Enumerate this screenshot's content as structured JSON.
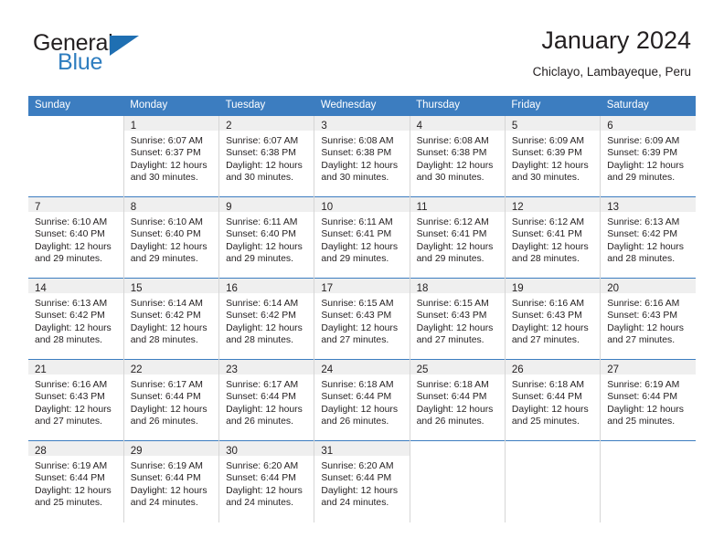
{
  "brand": {
    "word1": "General",
    "word2": "Blue",
    "accent_color": "#2E7DBF",
    "triangle_color": "#1F6FB2",
    "icon": "brand-triangle-icon"
  },
  "header": {
    "title": "January 2024",
    "location": "Chiclayo, Lambayeque, Peru"
  },
  "theme": {
    "header_blue": "#3C7DC0",
    "daynum_band": "#EFEFEF",
    "grid_line": "#D6D6D6",
    "text": "#231F20"
  },
  "calendar": {
    "weekday_headers": [
      "Sunday",
      "Monday",
      "Tuesday",
      "Wednesday",
      "Thursday",
      "Friday",
      "Saturday"
    ],
    "weeks": [
      [
        {
          "empty": true
        },
        {
          "day": "1",
          "sunrise": "Sunrise: 6:07 AM",
          "sunset": "Sunset: 6:37 PM",
          "daylight1": "Daylight: 12 hours",
          "daylight2": "and 30 minutes."
        },
        {
          "day": "2",
          "sunrise": "Sunrise: 6:07 AM",
          "sunset": "Sunset: 6:38 PM",
          "daylight1": "Daylight: 12 hours",
          "daylight2": "and 30 minutes."
        },
        {
          "day": "3",
          "sunrise": "Sunrise: 6:08 AM",
          "sunset": "Sunset: 6:38 PM",
          "daylight1": "Daylight: 12 hours",
          "daylight2": "and 30 minutes."
        },
        {
          "day": "4",
          "sunrise": "Sunrise: 6:08 AM",
          "sunset": "Sunset: 6:38 PM",
          "daylight1": "Daylight: 12 hours",
          "daylight2": "and 30 minutes."
        },
        {
          "day": "5",
          "sunrise": "Sunrise: 6:09 AM",
          "sunset": "Sunset: 6:39 PM",
          "daylight1": "Daylight: 12 hours",
          "daylight2": "and 30 minutes."
        },
        {
          "day": "6",
          "sunrise": "Sunrise: 6:09 AM",
          "sunset": "Sunset: 6:39 PM",
          "daylight1": "Daylight: 12 hours",
          "daylight2": "and 29 minutes."
        }
      ],
      [
        {
          "day": "7",
          "sunrise": "Sunrise: 6:10 AM",
          "sunset": "Sunset: 6:40 PM",
          "daylight1": "Daylight: 12 hours",
          "daylight2": "and 29 minutes."
        },
        {
          "day": "8",
          "sunrise": "Sunrise: 6:10 AM",
          "sunset": "Sunset: 6:40 PM",
          "daylight1": "Daylight: 12 hours",
          "daylight2": "and 29 minutes."
        },
        {
          "day": "9",
          "sunrise": "Sunrise: 6:11 AM",
          "sunset": "Sunset: 6:40 PM",
          "daylight1": "Daylight: 12 hours",
          "daylight2": "and 29 minutes."
        },
        {
          "day": "10",
          "sunrise": "Sunrise: 6:11 AM",
          "sunset": "Sunset: 6:41 PM",
          "daylight1": "Daylight: 12 hours",
          "daylight2": "and 29 minutes."
        },
        {
          "day": "11",
          "sunrise": "Sunrise: 6:12 AM",
          "sunset": "Sunset: 6:41 PM",
          "daylight1": "Daylight: 12 hours",
          "daylight2": "and 29 minutes."
        },
        {
          "day": "12",
          "sunrise": "Sunrise: 6:12 AM",
          "sunset": "Sunset: 6:41 PM",
          "daylight1": "Daylight: 12 hours",
          "daylight2": "and 28 minutes."
        },
        {
          "day": "13",
          "sunrise": "Sunrise: 6:13 AM",
          "sunset": "Sunset: 6:42 PM",
          "daylight1": "Daylight: 12 hours",
          "daylight2": "and 28 minutes."
        }
      ],
      [
        {
          "day": "14",
          "sunrise": "Sunrise: 6:13 AM",
          "sunset": "Sunset: 6:42 PM",
          "daylight1": "Daylight: 12 hours",
          "daylight2": "and 28 minutes."
        },
        {
          "day": "15",
          "sunrise": "Sunrise: 6:14 AM",
          "sunset": "Sunset: 6:42 PM",
          "daylight1": "Daylight: 12 hours",
          "daylight2": "and 28 minutes."
        },
        {
          "day": "16",
          "sunrise": "Sunrise: 6:14 AM",
          "sunset": "Sunset: 6:42 PM",
          "daylight1": "Daylight: 12 hours",
          "daylight2": "and 28 minutes."
        },
        {
          "day": "17",
          "sunrise": "Sunrise: 6:15 AM",
          "sunset": "Sunset: 6:43 PM",
          "daylight1": "Daylight: 12 hours",
          "daylight2": "and 27 minutes."
        },
        {
          "day": "18",
          "sunrise": "Sunrise: 6:15 AM",
          "sunset": "Sunset: 6:43 PM",
          "daylight1": "Daylight: 12 hours",
          "daylight2": "and 27 minutes."
        },
        {
          "day": "19",
          "sunrise": "Sunrise: 6:16 AM",
          "sunset": "Sunset: 6:43 PM",
          "daylight1": "Daylight: 12 hours",
          "daylight2": "and 27 minutes."
        },
        {
          "day": "20",
          "sunrise": "Sunrise: 6:16 AM",
          "sunset": "Sunset: 6:43 PM",
          "daylight1": "Daylight: 12 hours",
          "daylight2": "and 27 minutes."
        }
      ],
      [
        {
          "day": "21",
          "sunrise": "Sunrise: 6:16 AM",
          "sunset": "Sunset: 6:43 PM",
          "daylight1": "Daylight: 12 hours",
          "daylight2": "and 27 minutes."
        },
        {
          "day": "22",
          "sunrise": "Sunrise: 6:17 AM",
          "sunset": "Sunset: 6:44 PM",
          "daylight1": "Daylight: 12 hours",
          "daylight2": "and 26 minutes."
        },
        {
          "day": "23",
          "sunrise": "Sunrise: 6:17 AM",
          "sunset": "Sunset: 6:44 PM",
          "daylight1": "Daylight: 12 hours",
          "daylight2": "and 26 minutes."
        },
        {
          "day": "24",
          "sunrise": "Sunrise: 6:18 AM",
          "sunset": "Sunset: 6:44 PM",
          "daylight1": "Daylight: 12 hours",
          "daylight2": "and 26 minutes."
        },
        {
          "day": "25",
          "sunrise": "Sunrise: 6:18 AM",
          "sunset": "Sunset: 6:44 PM",
          "daylight1": "Daylight: 12 hours",
          "daylight2": "and 26 minutes."
        },
        {
          "day": "26",
          "sunrise": "Sunrise: 6:18 AM",
          "sunset": "Sunset: 6:44 PM",
          "daylight1": "Daylight: 12 hours",
          "daylight2": "and 25 minutes."
        },
        {
          "day": "27",
          "sunrise": "Sunrise: 6:19 AM",
          "sunset": "Sunset: 6:44 PM",
          "daylight1": "Daylight: 12 hours",
          "daylight2": "and 25 minutes."
        }
      ],
      [
        {
          "day": "28",
          "sunrise": "Sunrise: 6:19 AM",
          "sunset": "Sunset: 6:44 PM",
          "daylight1": "Daylight: 12 hours",
          "daylight2": "and 25 minutes."
        },
        {
          "day": "29",
          "sunrise": "Sunrise: 6:19 AM",
          "sunset": "Sunset: 6:44 PM",
          "daylight1": "Daylight: 12 hours",
          "daylight2": "and 24 minutes."
        },
        {
          "day": "30",
          "sunrise": "Sunrise: 6:20 AM",
          "sunset": "Sunset: 6:44 PM",
          "daylight1": "Daylight: 12 hours",
          "daylight2": "and 24 minutes."
        },
        {
          "day": "31",
          "sunrise": "Sunrise: 6:20 AM",
          "sunset": "Sunset: 6:44 PM",
          "daylight1": "Daylight: 12 hours",
          "daylight2": "and 24 minutes."
        },
        {
          "empty": true
        },
        {
          "empty": true
        },
        {
          "empty": true
        }
      ]
    ]
  }
}
